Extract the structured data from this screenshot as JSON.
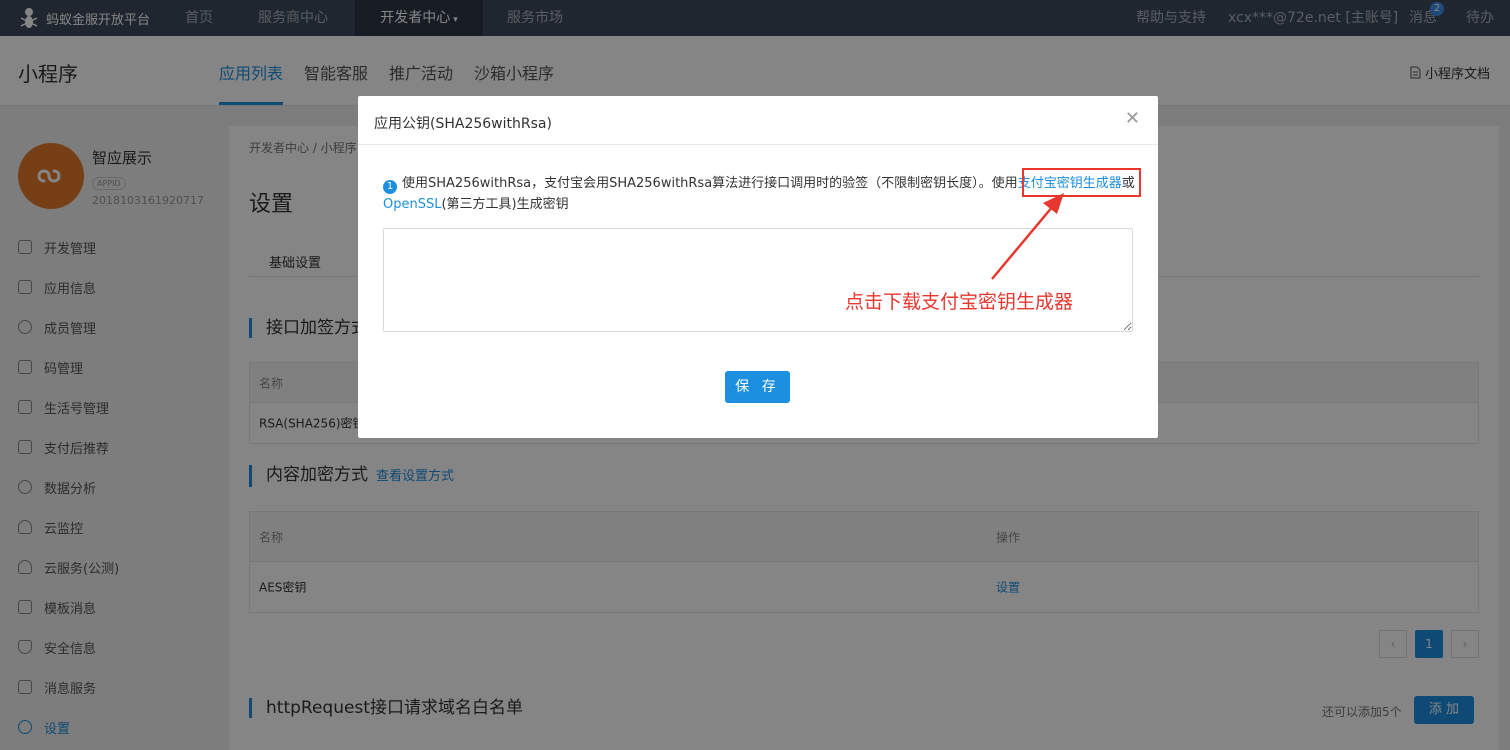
{
  "topnav": {
    "brand": "蚂蚁金服开放平台",
    "items": [
      "首页",
      "服务商中心",
      "开发者中心",
      "服务市场"
    ],
    "help": "帮助与支持",
    "account": "xcx***@72e.net [主账号]",
    "messages": "消息",
    "message_count": "2",
    "todo": "待办"
  },
  "subheader": {
    "title": "小程序",
    "tabs": [
      "应用列表",
      "智能客服",
      "推广活动",
      "沙箱小程序"
    ],
    "doc_link": "小程序文档"
  },
  "app": {
    "name": "智应展示",
    "id_tag": "APPID",
    "id": "2018103161920717"
  },
  "sidebar": {
    "items": [
      {
        "label": "开发管理",
        "icon": "code-icon"
      },
      {
        "label": "应用信息",
        "icon": "grid-icon"
      },
      {
        "label": "成员管理",
        "icon": "member-icon"
      },
      {
        "label": "码管理",
        "icon": "qrcode-icon"
      },
      {
        "label": "生活号管理",
        "icon": "life-icon"
      },
      {
        "label": "支付后推荐",
        "icon": "monitor-icon"
      },
      {
        "label": "数据分析",
        "icon": "chart-icon"
      },
      {
        "label": "云监控",
        "icon": "cloud-icon"
      },
      {
        "label": "云服务(公测)",
        "icon": "cloud-icon"
      },
      {
        "label": "模板消息",
        "icon": "message-icon"
      },
      {
        "label": "安全信息",
        "icon": "shield-icon"
      },
      {
        "label": "消息服务",
        "icon": "service-icon"
      },
      {
        "label": "设置",
        "icon": "gear-icon"
      }
    ]
  },
  "main": {
    "breadcrumb": "开发者中心 / 小程序",
    "title": "设置",
    "subtab": "基础设置",
    "section1": "接口加签方式",
    "table1": {
      "col_name": "名称",
      "row_name": "RSA(SHA256)密钥"
    },
    "section2": "内容加密方式",
    "section2_link": "查看设置方式",
    "table2": {
      "col_name": "名称",
      "col_op": "操作",
      "row_name": "AES密钥",
      "row_op": "设置"
    },
    "page": "1",
    "section3": "httpRequest接口请求域名白名单",
    "add_hint": "还可以添加5个",
    "add_button": "添 加"
  },
  "modal": {
    "title": "应用公钥(SHA256withRsa)",
    "info_icon": "1",
    "info_text": "使用SHA256withRsa，支付宝会用SHA256withRsa算法进行接口调用时的验签（不限制密钥长度）。使用",
    "link1": "支付宝密钥生成器",
    "or": "或",
    "link2": "OpenSSL",
    "info_tail": "(第三方工具)生成密钥",
    "textarea_value": "",
    "save_button": "保 存"
  },
  "annotation": {
    "text": "点击下载支付宝密钥生成器",
    "color": "#e8372f"
  },
  "colors": {
    "accent": "#1c8fe0",
    "topnav_bg": "#3f4a5c"
  }
}
